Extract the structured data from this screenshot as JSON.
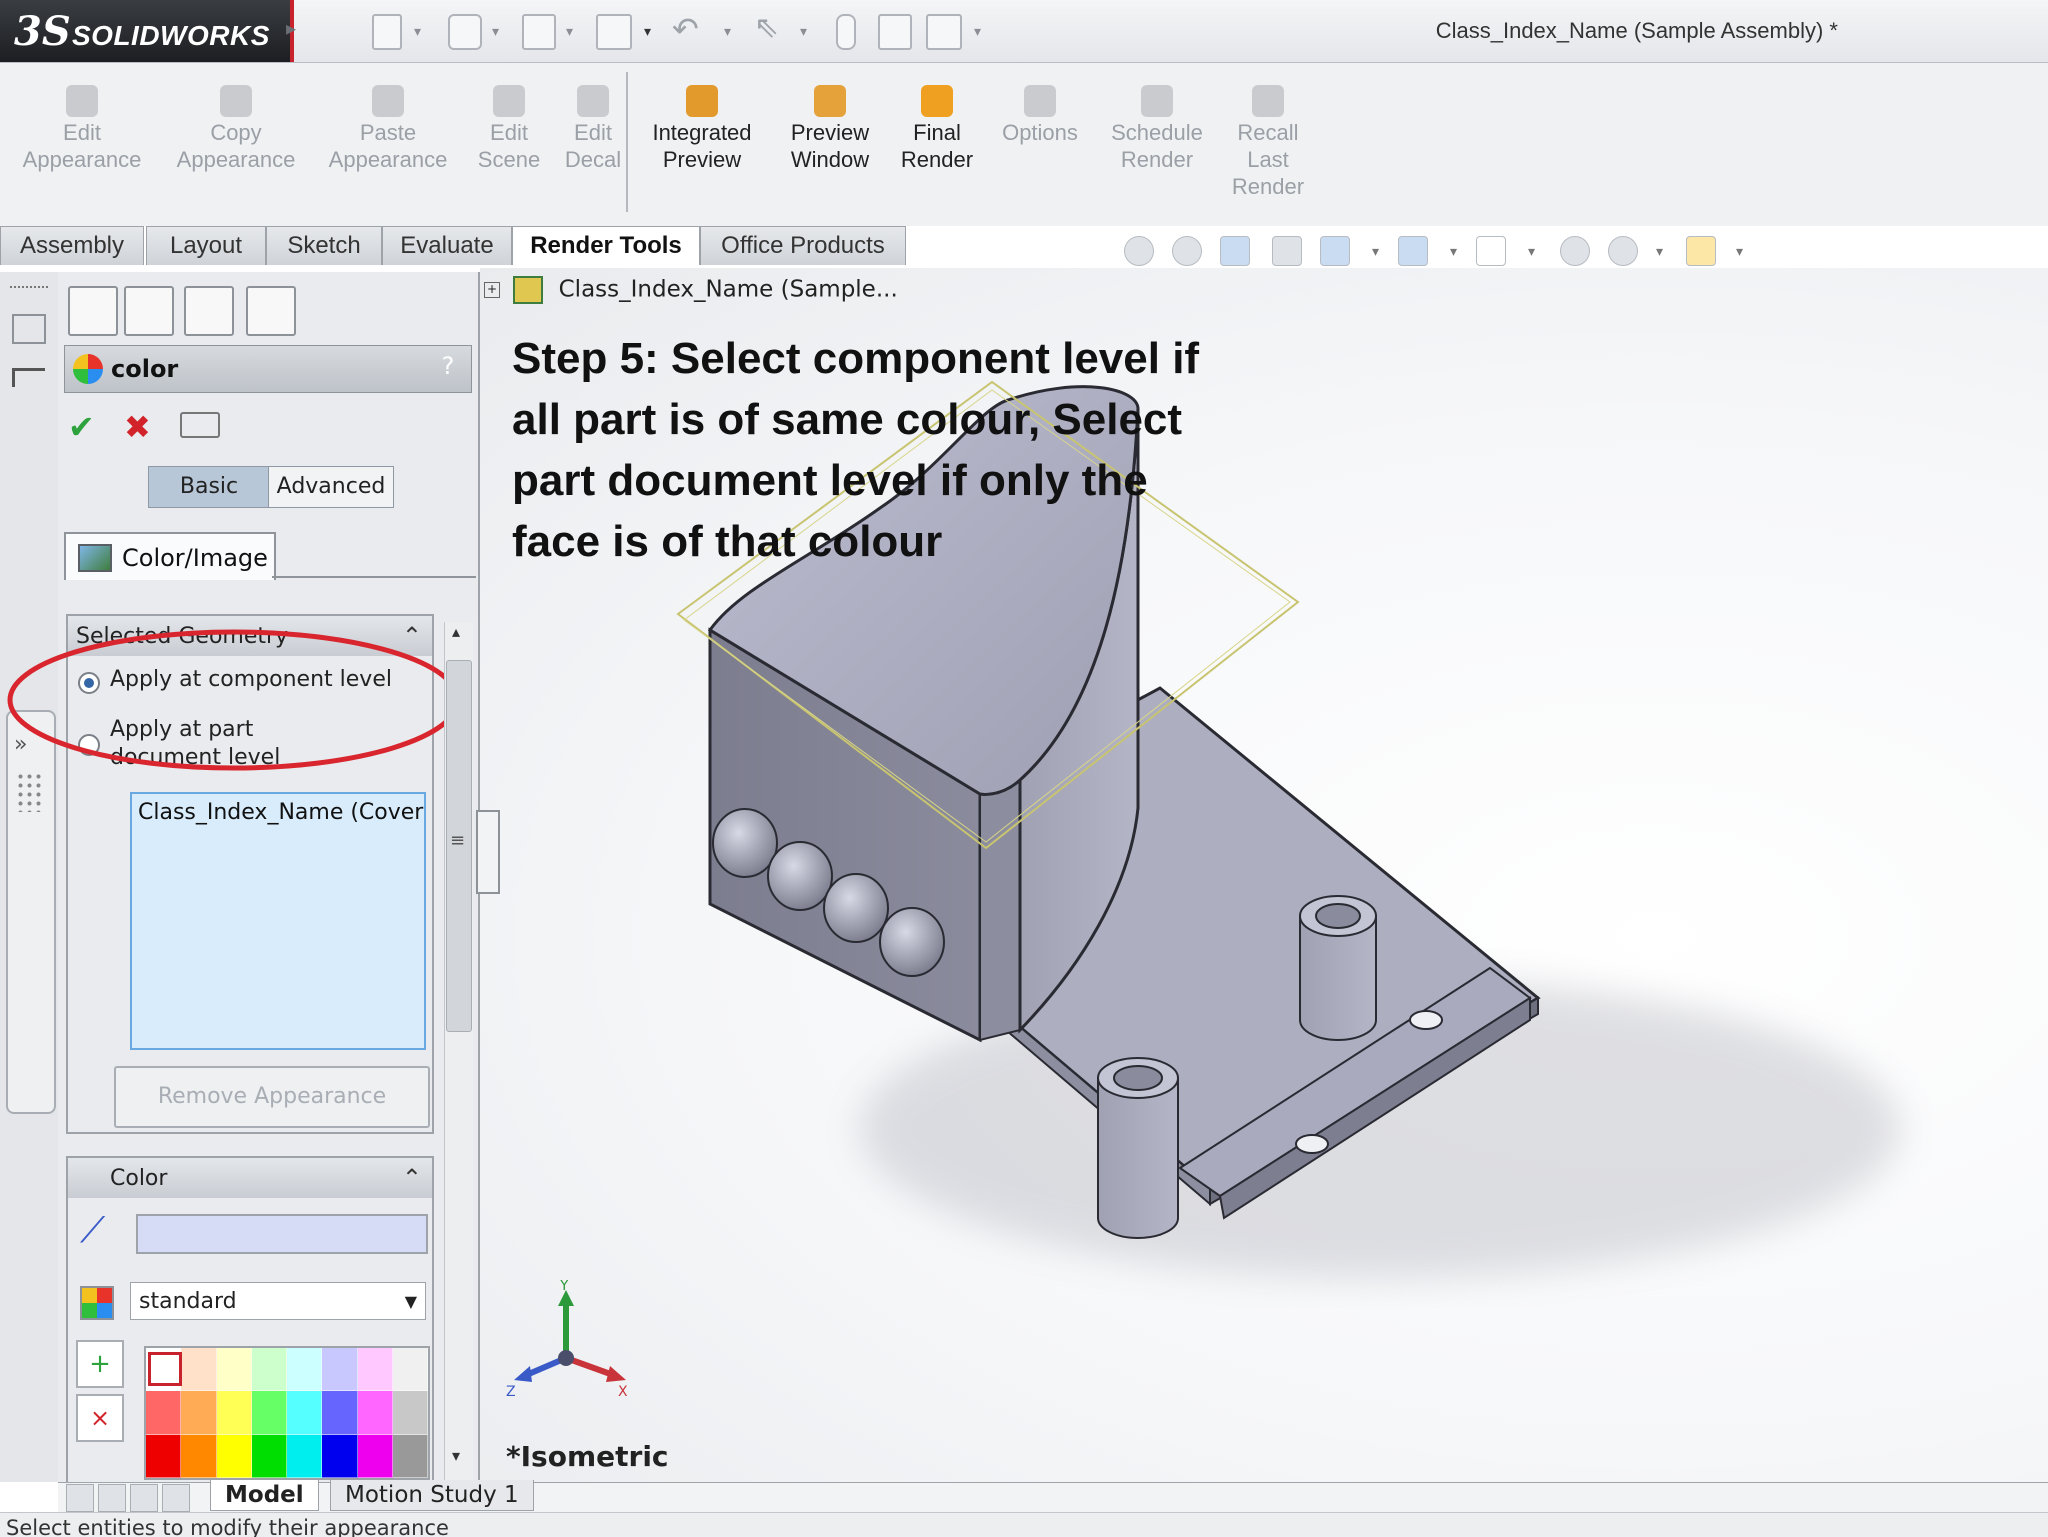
{
  "app": {
    "brand_mark": "3S",
    "brand_name": "SOLIDWORKS",
    "window_title": "Class_Index_Name (Sample Assembly) *"
  },
  "command_manager": [
    {
      "label_lines": [
        "Edit",
        "Appearance"
      ],
      "enabled": false,
      "icon": "appearance-icon"
    },
    {
      "label_lines": [
        "Copy",
        "Appearance"
      ],
      "enabled": false,
      "icon": "copy-appearance-icon"
    },
    {
      "label_lines": [
        "Paste",
        "Appearance"
      ],
      "enabled": false,
      "icon": "paste-appearance-icon"
    },
    {
      "label_lines": [
        "Edit",
        "Scene"
      ],
      "enabled": false,
      "icon": "scene-icon"
    },
    {
      "label_lines": [
        "Edit",
        "Decal"
      ],
      "enabled": false,
      "icon": "decal-icon"
    },
    {
      "label_lines": [
        "Integrated",
        "Preview"
      ],
      "enabled": true,
      "icon": "integrated-preview-icon"
    },
    {
      "label_lines": [
        "Preview",
        "Window"
      ],
      "enabled": true,
      "icon": "preview-window-icon"
    },
    {
      "label_lines": [
        "Final",
        "Render"
      ],
      "enabled": true,
      "icon": "final-render-icon"
    },
    {
      "label_lines": [
        "Options"
      ],
      "enabled": false,
      "icon": "options-icon"
    },
    {
      "label_lines": [
        "Schedule",
        "Render"
      ],
      "enabled": false,
      "icon": "schedule-render-icon"
    },
    {
      "label_lines": [
        "Recall",
        "Last",
        "Render"
      ],
      "enabled": false,
      "icon": "recall-render-icon"
    }
  ],
  "tabs": [
    "Assembly",
    "Layout",
    "Sketch",
    "Evaluate",
    "Render Tools",
    "Office Products"
  ],
  "active_tab": "Render Tools",
  "feature_tree": {
    "root": "Class_Index_Name (Sample..."
  },
  "property_manager": {
    "title": "color",
    "help": "?",
    "mode_buttons": {
      "basic": "Basic",
      "advanced": "Advanced",
      "selected": "Basic"
    },
    "subtab": "Color/Image",
    "selected_geometry": {
      "header": "Selected Geometry",
      "options": [
        "Apply at component level",
        "Apply at part document level"
      ],
      "selected_option": "Apply at component level",
      "list_items": [
        "Class_Index_Name (Cover /"
      ],
      "remove_button": "Remove Appearance"
    },
    "color": {
      "header": "Color",
      "palette_select": "standard",
      "swatches": [
        [
          "#ffffff",
          "#ffe0c8",
          "#ffffc8",
          "#ccffcc",
          "#ccffff",
          "#c8c8ff",
          "#ffc8ff",
          "#f0f0f0"
        ],
        [
          "#ff6666",
          "#ffaa55",
          "#ffff55",
          "#66ff66",
          "#55ffff",
          "#6666ff",
          "#ff66ff",
          "#c8c8c8"
        ],
        [
          "#ee0000",
          "#ff8800",
          "#ffff00",
          "#00dd00",
          "#00eeee",
          "#0000ee",
          "#ee00ee",
          "#999999"
        ]
      ]
    }
  },
  "annotation": {
    "lines": [
      "Step 5: Select component level if",
      "all part is of same colour, Select",
      "part document level if only the",
      "face is of that colour"
    ],
    "highlight_color": "#d9262e"
  },
  "viewport": {
    "view_name": "*Isometric",
    "axes": {
      "x": "X",
      "y": "Y",
      "z": "Z"
    }
  },
  "bottom_tabs": [
    "Model",
    "Motion Study 1"
  ],
  "active_bottom_tab": "Model",
  "status_text": "Select entities to modify their appearance"
}
